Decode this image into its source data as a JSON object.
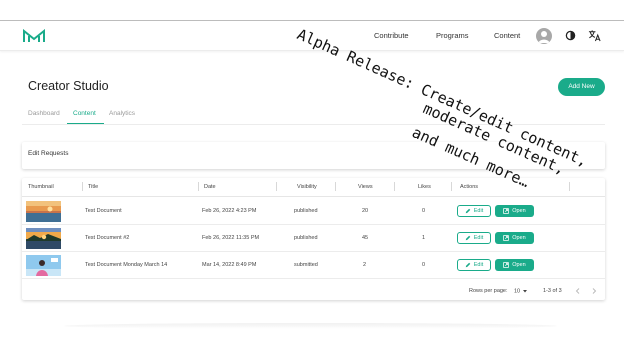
{
  "navbar": {
    "links": [
      "Contribute",
      "Programs",
      "Content"
    ]
  },
  "header": {
    "title": "Creator Studio",
    "add_new_label": "Add New"
  },
  "tabs": [
    {
      "label": "Dashboard",
      "active": false
    },
    {
      "label": "Content",
      "active": true
    },
    {
      "label": "Analytics",
      "active": false
    }
  ],
  "edit_requests": {
    "title": "Edit Requests"
  },
  "table": {
    "columns": [
      "Thumbnail",
      "Title",
      "Date",
      "Visibility",
      "Views",
      "Likes",
      "Actions"
    ],
    "rows": [
      {
        "title": "Test Document",
        "date": "Feb 26, 2022 4:23 PM",
        "visibility": "published",
        "views": "20",
        "likes": "0",
        "thumbnail": "sunset-sea"
      },
      {
        "title": "Test Document #2",
        "date": "Feb 26, 2022 11:35 PM",
        "visibility": "published",
        "views": "45",
        "likes": "1",
        "thumbnail": "island-sunset"
      },
      {
        "title": "Test Document Monday March 14",
        "date": "Mar 14, 2022 8:49 PM",
        "visibility": "submitted",
        "views": "2",
        "likes": "0",
        "thumbnail": "person-on-sky"
      }
    ],
    "edit_label": "Edit",
    "open_label": "Open",
    "rows_per_page_label": "Rows per page:",
    "rows_per_page_value": "10",
    "pagination_text": "1-3 of 3"
  },
  "overlay": {
    "line1": "Alpha Release: Create/edit content,",
    "line2": "moderate content,",
    "line3": "and much more…"
  },
  "colors": {
    "accent": "#1aab8a",
    "text": "#222222"
  }
}
